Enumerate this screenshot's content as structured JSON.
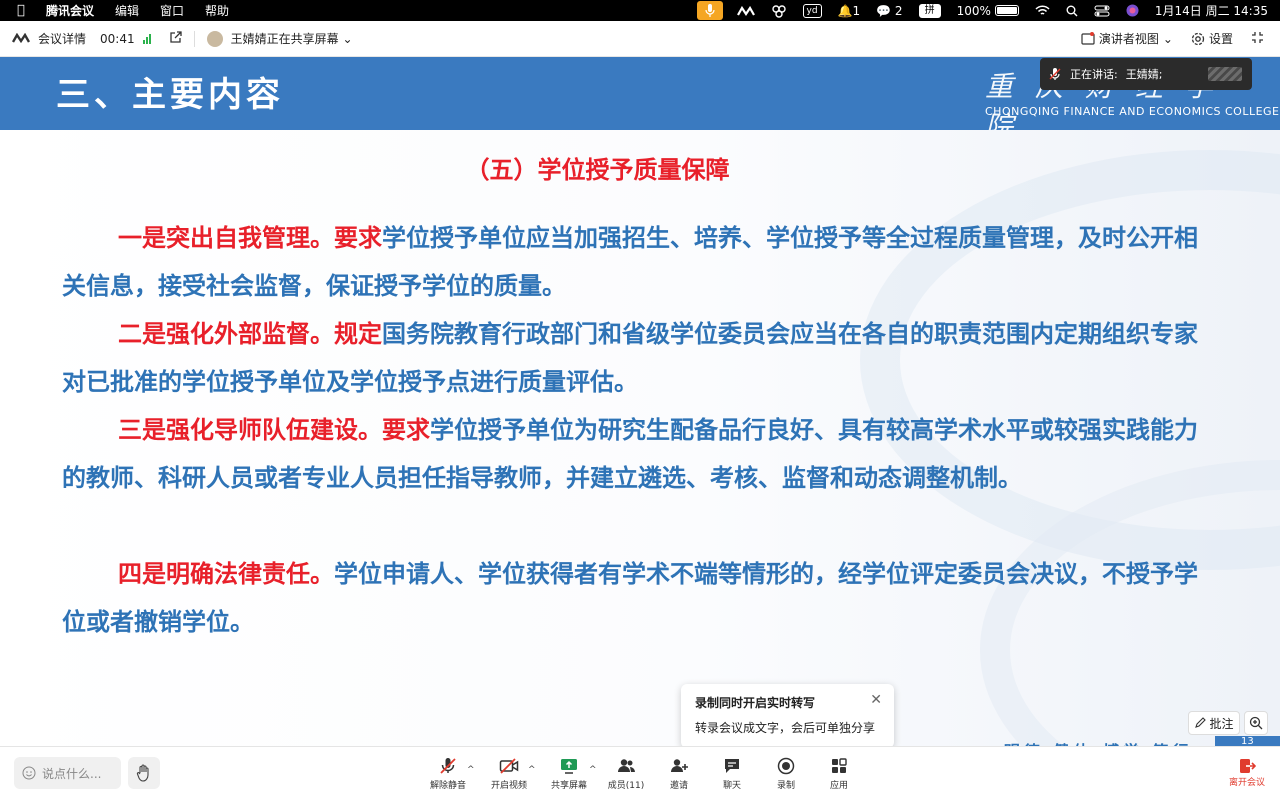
{
  "menubar": {
    "app_name": "腾讯会议",
    "menus": [
      "编辑",
      "窗口",
      "帮助"
    ],
    "notifications": "1",
    "wechat": "2",
    "ime": "拼",
    "battery": "100%",
    "datetime": "1月14日 周二  14:35"
  },
  "topbar": {
    "meeting_details": "会议详情",
    "timer": "00:41",
    "sharing_label": "王婧婧正在共享屏幕",
    "presenter_view": "演讲者视图",
    "settings": "设置"
  },
  "speaking": {
    "label": "正在讲话:",
    "name": "王婧婧;"
  },
  "slide": {
    "title": "三、主要内容",
    "college_cn": "重庆财经学院",
    "college_en": "CHONGQING FINANCE AND ECONOMICS COLLEGE",
    "subtitle": "（五）学位授予质量保障",
    "paragraphs": [
      {
        "red": "一是突出自我管理。要求",
        "blue": "学位授予单位应当加强招生、培养、学位授予等全过程质量管理，及时公开相关信息，接受社会监督，保证授予学位的质量。"
      },
      {
        "red": "二是强化外部监督。规定",
        "blue": "国务院教育行政部门和省级学位委员会应当在各自的职责范围内定期组织专家对已批准的学位授予单位及学位授予点进行质量评估。"
      },
      {
        "red": "三是强化导师队伍建设。要求",
        "blue": "学位授予单位为研究生配备品行良好、具有较高学术水平或较强实践能力的教师、科研人员或者专业人员担任指导教师，并建立遴选、考核、监督和动态调整机制。"
      },
      {
        "red": "四是明确法律责任。",
        "blue": "学位申请人、学位获得者有学术不端等情形的，经学位评定委员会决议，不授予学位或者撤销学位。"
      }
    ],
    "footer_motto": "• 明德 健体 博学 笃行",
    "page_number": "13"
  },
  "popup": {
    "title": "录制同时开启实时转写",
    "body": "转录会议成文字，会后可单独分享"
  },
  "annotate": "批注",
  "toolbar": {
    "chat_placeholder": "说点什么...",
    "unmute": "解除静音",
    "start_video": "开启视频",
    "share_screen": "共享屏幕",
    "members": "成员(11)",
    "invite": "邀请",
    "chat": "聊天",
    "record": "录制",
    "apps": "应用",
    "leave": "离开会议"
  },
  "colors": {
    "header_blue": "#3a7ac0",
    "text_blue": "#2e73b6",
    "text_red": "#e8202a",
    "leave_red": "#e03b2e"
  }
}
